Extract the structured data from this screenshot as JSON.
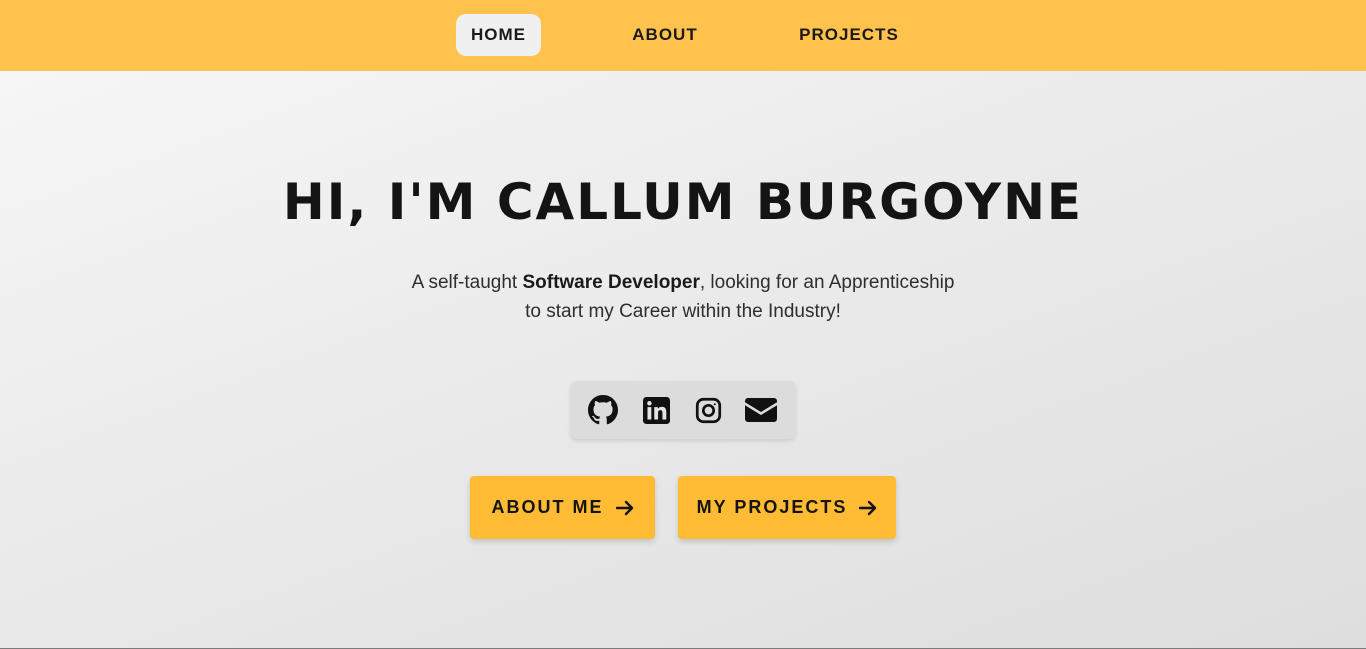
{
  "nav": {
    "items": [
      {
        "label": "HOME",
        "active": true
      },
      {
        "label": "ABOUT",
        "active": false
      },
      {
        "label": "PROJECTS",
        "active": false
      }
    ]
  },
  "hero": {
    "title": "HI, I'M CALLUM BURGOYNE",
    "subtitle": {
      "line1_prefix": "A self-taught ",
      "line1_bold": "Software Developer",
      "line1_suffix": ", looking for an Apprenticeship",
      "line2": "to start my Career within the Industry!"
    }
  },
  "social": [
    {
      "icon": "github-icon"
    },
    {
      "icon": "linkedin-icon"
    },
    {
      "icon": "instagram-icon"
    },
    {
      "icon": "envelope-icon"
    }
  ],
  "buttons": {
    "about_me": "ABOUT ME",
    "my_projects": "MY PROJECTS"
  },
  "colors": {
    "nav_bg": "#ffc24d",
    "button_bg": "#ffbb33",
    "active_nav_bg": "#f0f0f0",
    "text": "#141414"
  }
}
